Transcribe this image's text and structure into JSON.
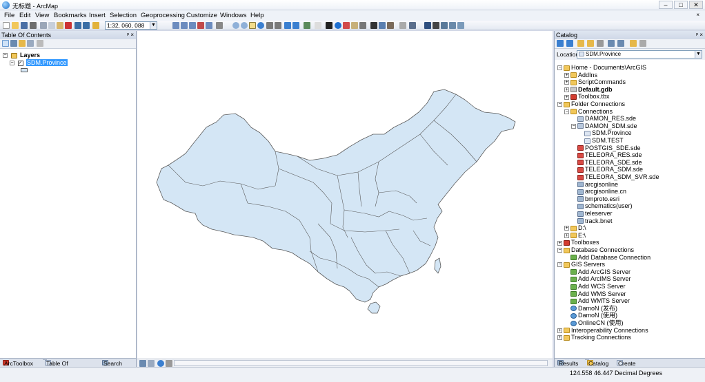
{
  "window": {
    "title": "无标题 - ArcMap"
  },
  "menu": [
    "File",
    "Edit",
    "View",
    "Bookmarks",
    "Insert",
    "Selection",
    "Geoprocessing",
    "Customize",
    "Windows",
    "Help"
  ],
  "toolbar": {
    "scale": "1:32, 060, 088"
  },
  "toc": {
    "title": "Table Of Contents",
    "layers_label": "Layers",
    "layer_name": "SDM.Province",
    "tabs": [
      "ArcToolbox",
      "Table Of Contents",
      "Search"
    ]
  },
  "catalog": {
    "title": "Catalog",
    "location_label": "Location:",
    "location_value": "SDM.Province",
    "tree": [
      {
        "label": "Home - Documents\\ArcGIS",
        "icon": "folder-icon",
        "level": 0,
        "exp": "-"
      },
      {
        "label": "AddIns",
        "icon": "folder-icon",
        "level": 1,
        "exp": "+"
      },
      {
        "label": "ScriptCommands",
        "icon": "folder-icon",
        "level": 1,
        "exp": "+"
      },
      {
        "label": "Default.gdb",
        "icon": "geodatabase-icon",
        "level": 1,
        "exp": "+",
        "bold": true
      },
      {
        "label": "Toolbox.tbx",
        "icon": "toolbox-icon",
        "level": 1,
        "exp": "+"
      },
      {
        "label": "Folder Connections",
        "icon": "folder-icon",
        "level": 0,
        "exp": "-"
      },
      {
        "label": "Connections",
        "icon": "folder-icon",
        "level": 1,
        "exp": "-"
      },
      {
        "label": "DAMON_RES.sde",
        "icon": "sde-connection-icon",
        "level": 2,
        "exp": ""
      },
      {
        "label": "DAMON_SDM.sde",
        "icon": "sde-connection-icon",
        "level": 2,
        "exp": "-"
      },
      {
        "label": "SDM.Province",
        "icon": "feature-class-icon",
        "level": 3,
        "exp": ""
      },
      {
        "label": "SDM.TEST",
        "icon": "feature-class-icon",
        "level": 3,
        "exp": ""
      },
      {
        "label": "POSTGIS_SDE.sde",
        "icon": "sde-error-icon",
        "level": 2,
        "exp": ""
      },
      {
        "label": "TELEORA_RES.sde",
        "icon": "sde-error-icon",
        "level": 2,
        "exp": ""
      },
      {
        "label": "TELEORA_SDE.sde",
        "icon": "sde-error-icon",
        "level": 2,
        "exp": ""
      },
      {
        "label": "TELEORA_SDM.sde",
        "icon": "sde-error-icon",
        "level": 2,
        "exp": ""
      },
      {
        "label": "TELEORA_SDM_SVR.sde",
        "icon": "sde-error-icon",
        "level": 2,
        "exp": ""
      },
      {
        "label": "arcgisonline",
        "icon": "server-icon",
        "level": 2,
        "exp": ""
      },
      {
        "label": "arcgisonline.cn",
        "icon": "server-icon",
        "level": 2,
        "exp": ""
      },
      {
        "label": "bmproto.esri",
        "icon": "server-icon",
        "level": 2,
        "exp": ""
      },
      {
        "label": "schematics(user)",
        "icon": "server-icon",
        "level": 2,
        "exp": ""
      },
      {
        "label": "teleserver",
        "icon": "server-icon",
        "level": 2,
        "exp": ""
      },
      {
        "label": "track.bnet",
        "icon": "server-icon",
        "level": 2,
        "exp": ""
      },
      {
        "label": "D:\\",
        "icon": "folder-icon",
        "level": 1,
        "exp": "+"
      },
      {
        "label": "E:\\",
        "icon": "folder-icon",
        "level": 1,
        "exp": "+"
      },
      {
        "label": "Toolboxes",
        "icon": "toolbox-icon",
        "level": 0,
        "exp": "+"
      },
      {
        "label": "Database Connections",
        "icon": "folder-icon",
        "level": 0,
        "exp": "-"
      },
      {
        "label": "Add Database Connection",
        "icon": "add-connection-icon",
        "level": 1,
        "exp": ""
      },
      {
        "label": "GIS Servers",
        "icon": "folder-icon",
        "level": 0,
        "exp": "-"
      },
      {
        "label": "Add ArcGIS Server",
        "icon": "add-connection-icon",
        "level": 1,
        "exp": ""
      },
      {
        "label": "Add ArcIMS Server",
        "icon": "add-connection-icon",
        "level": 1,
        "exp": ""
      },
      {
        "label": "Add WCS Server",
        "icon": "add-connection-icon",
        "level": 1,
        "exp": ""
      },
      {
        "label": "Add WMS Server",
        "icon": "add-connection-icon",
        "level": 1,
        "exp": ""
      },
      {
        "label": "Add WMTS Server",
        "icon": "add-connection-icon",
        "level": 1,
        "exp": ""
      },
      {
        "label": "DamoN (发布)",
        "icon": "globe-icon",
        "level": 1,
        "exp": ""
      },
      {
        "label": "DamoN (使用)",
        "icon": "globe-icon",
        "level": 1,
        "exp": ""
      },
      {
        "label": "OnlineCN (使用)",
        "icon": "globe-icon",
        "level": 1,
        "exp": ""
      },
      {
        "label": "Interoperability Connections",
        "icon": "folder-icon",
        "level": 0,
        "exp": "+"
      },
      {
        "label": "Tracking Connections",
        "icon": "folder-icon",
        "level": 0,
        "exp": "+"
      }
    ],
    "tabs": [
      "Results",
      "Catalog",
      "Create Features"
    ]
  },
  "status": {
    "coords": "124.558  46.447 Decimal Degrees"
  },
  "colors": {
    "map_fill": "#d4e6f5",
    "map_stroke": "#5a5a5a",
    "selection": "#3399ff"
  }
}
